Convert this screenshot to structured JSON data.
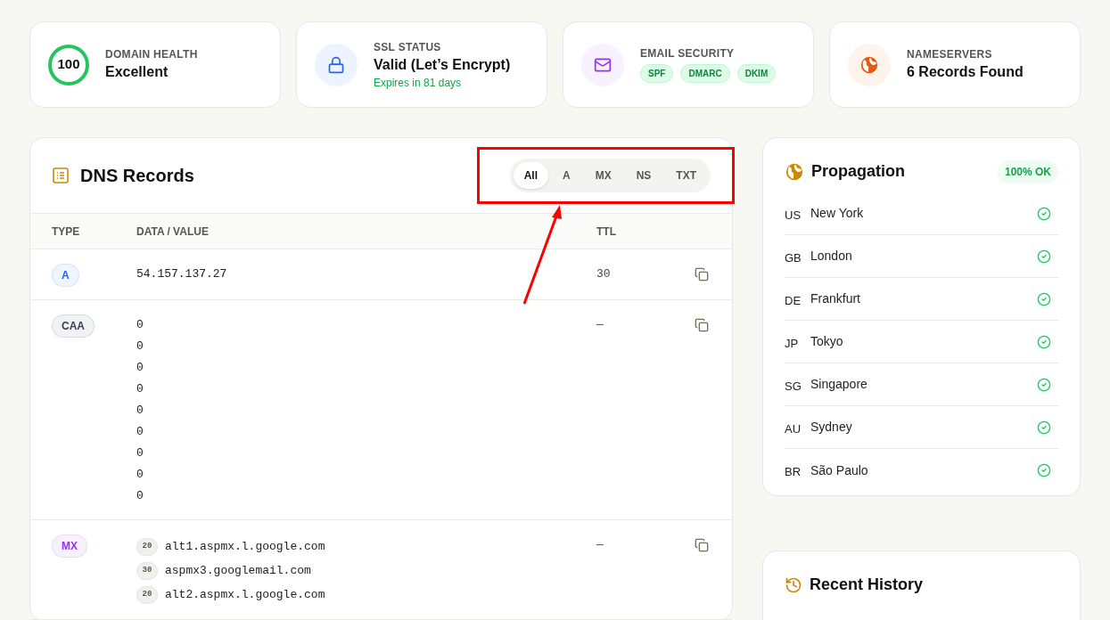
{
  "stats": [
    {
      "kind": "score",
      "score": "100",
      "label": "DOMAIN HEALTH",
      "value": "Excellent"
    },
    {
      "kind": "ssl",
      "label": "SSL STATUS",
      "value": "Valid (Let’s Encrypt)",
      "note": "Expires in 81 days"
    },
    {
      "kind": "email",
      "label": "EMAIL SECURITY",
      "tags": [
        "SPF",
        "DMARC",
        "DKIM"
      ]
    },
    {
      "kind": "ns",
      "label": "NAMESERVERS",
      "value": "6 Records Found"
    }
  ],
  "dns": {
    "title": "DNS Records",
    "filters": [
      {
        "label": "All",
        "selected": true
      },
      {
        "label": "A",
        "selected": false
      },
      {
        "label": "MX",
        "selected": false
      },
      {
        "label": "NS",
        "selected": false
      },
      {
        "label": "TXT",
        "selected": false
      }
    ],
    "columns": [
      "TYPE",
      "DATA / VALUE",
      "TTL"
    ],
    "records": [
      {
        "kind": "plain",
        "type": "A",
        "color": "#2563eb",
        "lines": [
          "54.157.137.27"
        ],
        "ttl": "30"
      },
      {
        "kind": "plain",
        "type": "CAA",
        "color": "#374151",
        "lines": [
          "0",
          "0",
          "0",
          "0",
          "0",
          "0",
          "0",
          "0",
          "0"
        ],
        "ttl": "—"
      },
      {
        "kind": "mx",
        "type": "MX",
        "color": "#9333ea",
        "entries": [
          {
            "priority": "20",
            "host": "alt1.aspmx.l.google.com"
          },
          {
            "priority": "30",
            "host": "aspmx3.googlemail.com"
          },
          {
            "priority": "20",
            "host": "alt2.aspmx.l.google.com"
          }
        ],
        "ttl": "—"
      }
    ]
  },
  "propagation": {
    "title": "Propagation",
    "badge": "100% OK",
    "locations": [
      {
        "code": "US",
        "city": "New York",
        "ok": true
      },
      {
        "code": "GB",
        "city": "London",
        "ok": true
      },
      {
        "code": "DE",
        "city": "Frankfurt",
        "ok": true
      },
      {
        "code": "JP",
        "city": "Tokyo",
        "ok": true
      },
      {
        "code": "SG",
        "city": "Singapore",
        "ok": true
      },
      {
        "code": "AU",
        "city": "Sydney",
        "ok": true
      },
      {
        "code": "BR",
        "city": "São Paulo",
        "ok": true
      }
    ]
  },
  "history": {
    "title": "Recent History"
  }
}
